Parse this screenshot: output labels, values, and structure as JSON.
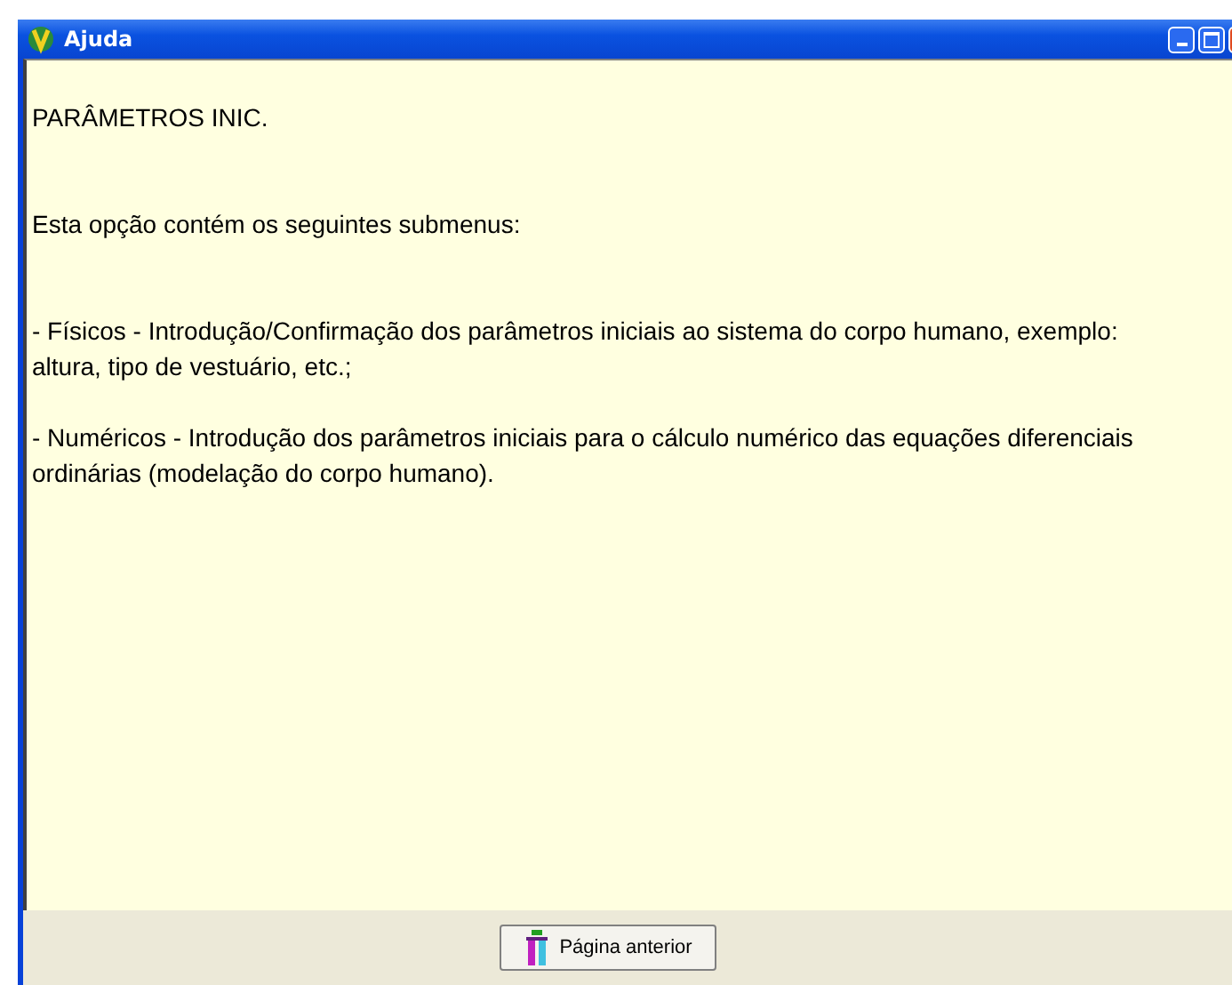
{
  "window": {
    "title": "Ajuda"
  },
  "content": {
    "paragraphs": [
      "PARÂMETROS INIC.",
      "Esta opção contém os seguintes submenus:",
      "- Físicos - Introdução/Confirmação dos parâmetros iniciais ao sistema do corpo humano, exemplo: altura, tipo de vestuário, etc.;",
      "- Numéricos - Introdução dos parâmetros iniciais para o cálculo numérico das equações diferenciais ordinárias (modelação do corpo humano)."
    ]
  },
  "buttons": [
    {
      "label": "Página anterior"
    }
  ]
}
